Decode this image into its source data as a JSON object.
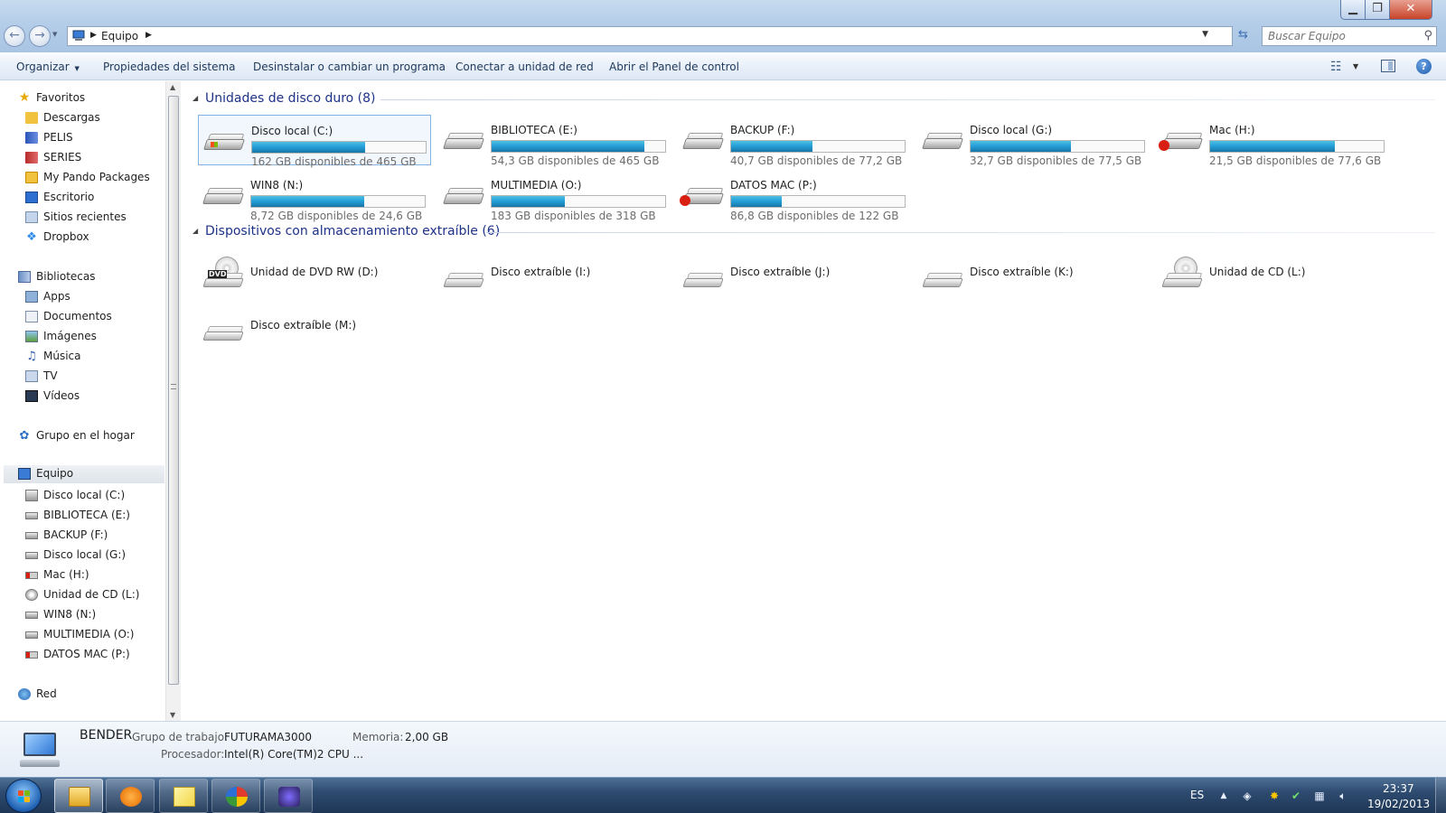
{
  "window": {
    "minimize_icon": "minimize-icon",
    "maximize_icon": "restore-icon",
    "close_icon": "close-icon",
    "close_glyph": "✕"
  },
  "address_bar": {
    "breadcrumb": [
      "Equipo"
    ],
    "search_placeholder": "Buscar Equipo"
  },
  "toolbar": {
    "organize": "Organizar",
    "system_properties": "Propiedades del sistema",
    "uninstall": "Desinstalar o cambiar un programa",
    "map_drive": "Conectar a unidad de red",
    "control_panel": "Abrir el Panel de control"
  },
  "nav": {
    "favorites_header": "Favoritos",
    "favorites": [
      "Descargas",
      "PELIS",
      "SERIES",
      "My Pando Packages",
      "Escritorio",
      "Sitios recientes",
      "Dropbox"
    ],
    "libraries_header": "Bibliotecas",
    "libraries": [
      "Apps",
      "Documentos",
      "Imágenes",
      "Música",
      "TV",
      "Vídeos"
    ],
    "homegroup": "Grupo en el hogar",
    "computer_header": "Equipo",
    "computer_items": [
      "Disco local (C:)",
      "BIBLIOTECA (E:)",
      "BACKUP (F:)",
      "Disco local (G:)",
      "Mac (H:)",
      "Unidad de CD (L:)",
      "WIN8 (N:)",
      "MULTIMEDIA (O:)",
      "DATOS MAC (P:)"
    ],
    "network": "Red"
  },
  "content": {
    "hard_drives_header": "Unidades de disco duro (8)",
    "hard_drives": [
      {
        "name": "Disco local (C:)",
        "free": "162 GB disponibles de 465 GB",
        "used_fraction": 0.65
      },
      {
        "name": "BIBLIOTECA (E:)",
        "free": "54,3 GB disponibles de 465 GB",
        "used_fraction": 0.88
      },
      {
        "name": "BACKUP (F:)",
        "free": "40,7 GB disponibles de 77,2 GB",
        "used_fraction": 0.47
      },
      {
        "name": "Disco local (G:)",
        "free": "32,7 GB disponibles de 77,5 GB",
        "used_fraction": 0.58
      },
      {
        "name": "Mac (H:)",
        "free": "21,5 GB disponibles de 77,6 GB",
        "used_fraction": 0.72
      },
      {
        "name": "WIN8 (N:)",
        "free": "8,72 GB disponibles de 24,6 GB",
        "used_fraction": 0.65
      },
      {
        "name": "MULTIMEDIA (O:)",
        "free": "183 GB disponibles de 318 GB",
        "used_fraction": 0.42
      },
      {
        "name": "DATOS MAC (P:)",
        "free": "86,8 GB disponibles de 122 GB",
        "used_fraction": 0.29
      }
    ],
    "removable_header": "Dispositivos con almacenamiento extraíble (6)",
    "removable": [
      "Unidad de DVD RW (D:)",
      "Disco extraíble (I:)",
      "Disco extraíble (J:)",
      "Disco extraíble (K:)",
      "Unidad de CD (L:)",
      "Disco extraíble (M:)"
    ],
    "dvd_label": "DVD"
  },
  "details": {
    "computer_name": "BENDER",
    "workgroup_label": "Grupo de trabajo:",
    "workgroup_value": "FUTURAMA3000",
    "memory_label": "Memoria:",
    "memory_value": "2,00 GB",
    "processor_label": "Procesador:",
    "processor_value": "Intel(R) Core(TM)2 CPU ..."
  },
  "taskbar": {
    "language": "ES",
    "time": "23:37",
    "date": "19/02/2013"
  },
  "colors": {
    "bar_fill": "#26a0da",
    "group_header": "#1e3287",
    "apple_red": "#d91f12"
  }
}
